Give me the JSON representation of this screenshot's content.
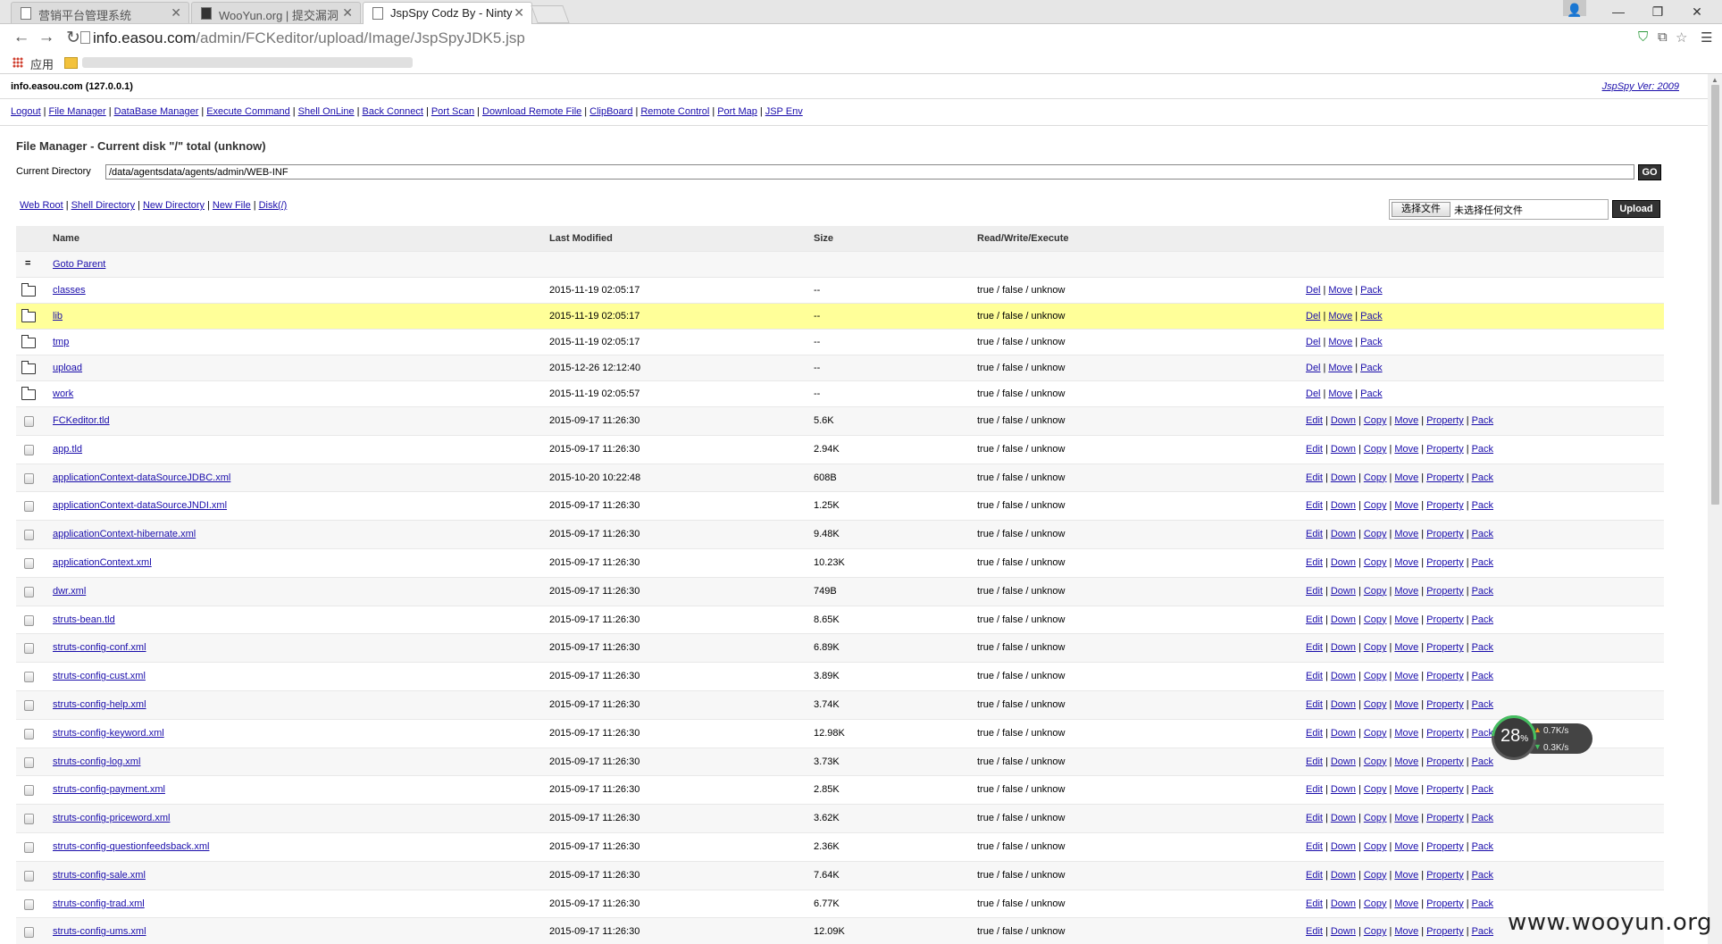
{
  "browser": {
    "tabs": [
      {
        "title": "营销平台管理系统"
      },
      {
        "title": "WooYun.org | 提交漏洞"
      },
      {
        "title": "JspSpy Codz By - Ninty"
      }
    ],
    "url_host": "info.easou.com",
    "url_path": "/admin/FCKeditor/upload/Image/JspSpyJDK5.jsp",
    "bookmarks_apps_label": "应用"
  },
  "header": {
    "host": "info.easou.com (127.0.0.1)",
    "version_link": "JspSpy Ver: 2009"
  },
  "nav_links": [
    "Logout",
    "File Manager",
    "DataBase Manager",
    "Execute Command",
    "Shell OnLine",
    "Back Connect",
    "Port Scan",
    "Download Remote File",
    "ClipBoard",
    "Remote Control",
    "Port Map",
    "JSP Env"
  ],
  "file_manager": {
    "title": "File Manager - Current disk \"/\" total (unknow)",
    "current_dir_label": "Current Directory",
    "current_dir_value": "/data/agentsdata/agents/admin/WEB-INF",
    "go_label": "GO",
    "quick_links": [
      "Web Root",
      "Shell Directory",
      "New Directory",
      "New File",
      "Disk(/)"
    ],
    "choose_file_label": "选择文件",
    "no_file_label": "未选择任何文件",
    "upload_label": "Upload"
  },
  "table": {
    "columns": [
      "Name",
      "Last Modified",
      "Size",
      "Read/Write/Execute"
    ],
    "goto_parent_icon": "=",
    "goto_parent": "Goto Parent",
    "rows": [
      {
        "type": "dir",
        "name": "classes",
        "modified": "2015-11-19 02:05:17",
        "size": "--",
        "rwx": "true / false / unknow",
        "actions": [
          "Del",
          "Move",
          "Pack"
        ]
      },
      {
        "type": "dir",
        "name": "lib",
        "modified": "2015-11-19 02:05:17",
        "size": "--",
        "rwx": "true / false / unknow",
        "actions": [
          "Del",
          "Move",
          "Pack"
        ],
        "highlight": true
      },
      {
        "type": "dir",
        "name": "tmp",
        "modified": "2015-11-19 02:05:17",
        "size": "--",
        "rwx": "true / false / unknow",
        "actions": [
          "Del",
          "Move",
          "Pack"
        ]
      },
      {
        "type": "dir",
        "name": "upload",
        "modified": "2015-12-26 12:12:40",
        "size": "--",
        "rwx": "true / false / unknow",
        "actions": [
          "Del",
          "Move",
          "Pack"
        ]
      },
      {
        "type": "dir",
        "name": "work",
        "modified": "2015-11-19 02:05:57",
        "size": "--",
        "rwx": "true / false / unknow",
        "actions": [
          "Del",
          "Move",
          "Pack"
        ]
      },
      {
        "type": "file",
        "name": "FCKeditor.tld",
        "modified": "2015-09-17 11:26:30",
        "size": "5.6K",
        "rwx": "true / false / unknow",
        "actions": [
          "Edit",
          "Down",
          "Copy",
          "Move",
          "Property",
          "Pack"
        ]
      },
      {
        "type": "file",
        "name": "app.tld",
        "modified": "2015-09-17 11:26:30",
        "size": "2.94K",
        "rwx": "true / false / unknow",
        "actions": [
          "Edit",
          "Down",
          "Copy",
          "Move",
          "Property",
          "Pack"
        ]
      },
      {
        "type": "file",
        "name": "applicationContext-dataSourceJDBC.xml",
        "modified": "2015-10-20 10:22:48",
        "size": "608B",
        "rwx": "true / false / unknow",
        "actions": [
          "Edit",
          "Down",
          "Copy",
          "Move",
          "Property",
          "Pack"
        ]
      },
      {
        "type": "file",
        "name": "applicationContext-dataSourceJNDI.xml",
        "modified": "2015-09-17 11:26:30",
        "size": "1.25K",
        "rwx": "true / false / unknow",
        "actions": [
          "Edit",
          "Down",
          "Copy",
          "Move",
          "Property",
          "Pack"
        ]
      },
      {
        "type": "file",
        "name": "applicationContext-hibernate.xml",
        "modified": "2015-09-17 11:26:30",
        "size": "9.48K",
        "rwx": "true / false / unknow",
        "actions": [
          "Edit",
          "Down",
          "Copy",
          "Move",
          "Property",
          "Pack"
        ]
      },
      {
        "type": "file",
        "name": "applicationContext.xml",
        "modified": "2015-09-17 11:26:30",
        "size": "10.23K",
        "rwx": "true / false / unknow",
        "actions": [
          "Edit",
          "Down",
          "Copy",
          "Move",
          "Property",
          "Pack"
        ]
      },
      {
        "type": "file",
        "name": "dwr.xml",
        "modified": "2015-09-17 11:26:30",
        "size": "749B",
        "rwx": "true / false / unknow",
        "actions": [
          "Edit",
          "Down",
          "Copy",
          "Move",
          "Property",
          "Pack"
        ]
      },
      {
        "type": "file",
        "name": "struts-bean.tld",
        "modified": "2015-09-17 11:26:30",
        "size": "8.65K",
        "rwx": "true / false / unknow",
        "actions": [
          "Edit",
          "Down",
          "Copy",
          "Move",
          "Property",
          "Pack"
        ]
      },
      {
        "type": "file",
        "name": "struts-config-conf.xml",
        "modified": "2015-09-17 11:26:30",
        "size": "6.89K",
        "rwx": "true / false / unknow",
        "actions": [
          "Edit",
          "Down",
          "Copy",
          "Move",
          "Property",
          "Pack"
        ]
      },
      {
        "type": "file",
        "name": "struts-config-cust.xml",
        "modified": "2015-09-17 11:26:30",
        "size": "3.89K",
        "rwx": "true / false / unknow",
        "actions": [
          "Edit",
          "Down",
          "Copy",
          "Move",
          "Property",
          "Pack"
        ]
      },
      {
        "type": "file",
        "name": "struts-config-help.xml",
        "modified": "2015-09-17 11:26:30",
        "size": "3.74K",
        "rwx": "true / false / unknow",
        "actions": [
          "Edit",
          "Down",
          "Copy",
          "Move",
          "Property",
          "Pack"
        ]
      },
      {
        "type": "file",
        "name": "struts-config-keyword.xml",
        "modified": "2015-09-17 11:26:30",
        "size": "12.98K",
        "rwx": "true / false / unknow",
        "actions": [
          "Edit",
          "Down",
          "Copy",
          "Move",
          "Property",
          "Pack"
        ]
      },
      {
        "type": "file",
        "name": "struts-config-log.xml",
        "modified": "2015-09-17 11:26:30",
        "size": "3.73K",
        "rwx": "true / false / unknow",
        "actions": [
          "Edit",
          "Down",
          "Copy",
          "Move",
          "Property",
          "Pack"
        ]
      },
      {
        "type": "file",
        "name": "struts-config-payment.xml",
        "modified": "2015-09-17 11:26:30",
        "size": "2.85K",
        "rwx": "true / false / unknow",
        "actions": [
          "Edit",
          "Down",
          "Copy",
          "Move",
          "Property",
          "Pack"
        ]
      },
      {
        "type": "file",
        "name": "struts-config-priceword.xml",
        "modified": "2015-09-17 11:26:30",
        "size": "3.62K",
        "rwx": "true / false / unknow",
        "actions": [
          "Edit",
          "Down",
          "Copy",
          "Move",
          "Property",
          "Pack"
        ]
      },
      {
        "type": "file",
        "name": "struts-config-questionfeedsback.xml",
        "modified": "2015-09-17 11:26:30",
        "size": "2.36K",
        "rwx": "true / false / unknow",
        "actions": [
          "Edit",
          "Down",
          "Copy",
          "Move",
          "Property",
          "Pack"
        ]
      },
      {
        "type": "file",
        "name": "struts-config-sale.xml",
        "modified": "2015-09-17 11:26:30",
        "size": "7.64K",
        "rwx": "true / false / unknow",
        "actions": [
          "Edit",
          "Down",
          "Copy",
          "Move",
          "Property",
          "Pack"
        ]
      },
      {
        "type": "file",
        "name": "struts-config-trad.xml",
        "modified": "2015-09-17 11:26:30",
        "size": "6.77K",
        "rwx": "true / false / unknow",
        "actions": [
          "Edit",
          "Down",
          "Copy",
          "Move",
          "Property",
          "Pack"
        ]
      },
      {
        "type": "file",
        "name": "struts-config-ums.xml",
        "modified": "2015-09-17 11:26:30",
        "size": "12.09K",
        "rwx": "true / false / unknow",
        "actions": [
          "Edit",
          "Down",
          "Copy",
          "Move",
          "Property",
          "Pack"
        ]
      }
    ]
  },
  "speed_widget": {
    "percent": "28",
    "percent_unit": "%",
    "up": "0.7K/s",
    "down": "0.3K/s"
  },
  "watermark": "www.wooyun.org",
  "colors": {
    "link": "#1a0dab",
    "highlight_row": "#ffff99",
    "header_row": "#eeeeee",
    "button_dark": "#333333"
  }
}
